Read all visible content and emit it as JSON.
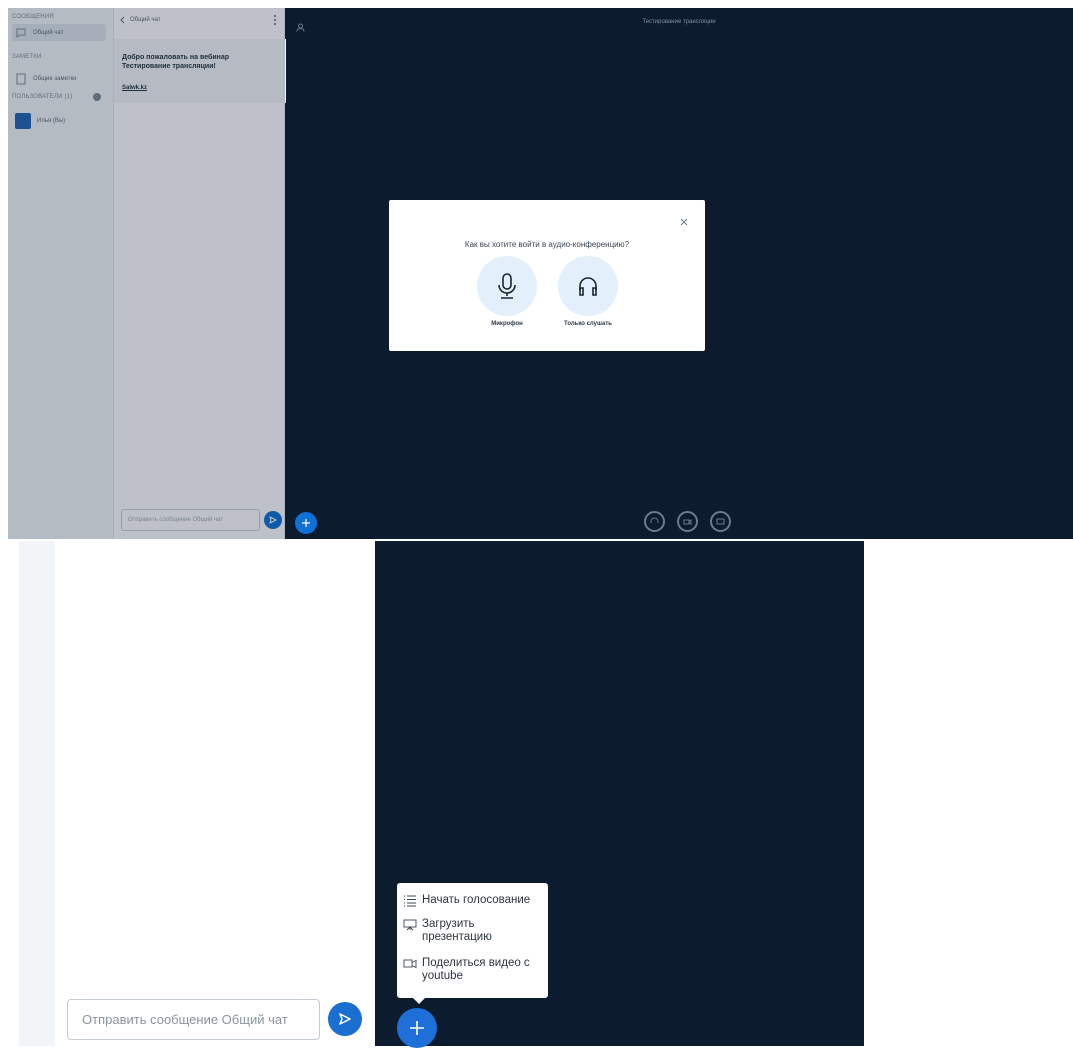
{
  "sidebar": {
    "messages_title": "СООБЩЕНИЯ",
    "public_chat": "Общий чат",
    "notes_title": "ЗАМЕТКИ",
    "shared_notes": "Общие заметки",
    "users_title": "ПОЛЬЗОВАТЕЛИ (1)",
    "user_name": "Илья (Вы)"
  },
  "chat": {
    "header_title": "Общий чат",
    "welcome_text": "Добро пожаловать на вебинар Тестирование трансляции!",
    "welcome_link": "Salwk.kz",
    "input_placeholder": "Отправить сообщение Общий чат"
  },
  "stage": {
    "title": "Тестирование трансляции"
  },
  "audio_modal": {
    "question": "Как вы хотите войти в аудио-конференцию?",
    "mic_label": "Микрофон",
    "listen_label": "Только слушать"
  },
  "actions_menu": {
    "items": [
      {
        "label": "Начать голосование",
        "icon": "poll-list-icon"
      },
      {
        "label": "Загрузить\nпрезентацию",
        "icon": "presentation-icon"
      },
      {
        "label": "Поделиться видео с\nyoutube",
        "icon": "video-camera-icon"
      }
    ]
  },
  "colors": {
    "stage_bg": "#0d1b2e",
    "accent_blue": "#1f6fd8",
    "modal_option_bg": "#e3f0fb"
  }
}
